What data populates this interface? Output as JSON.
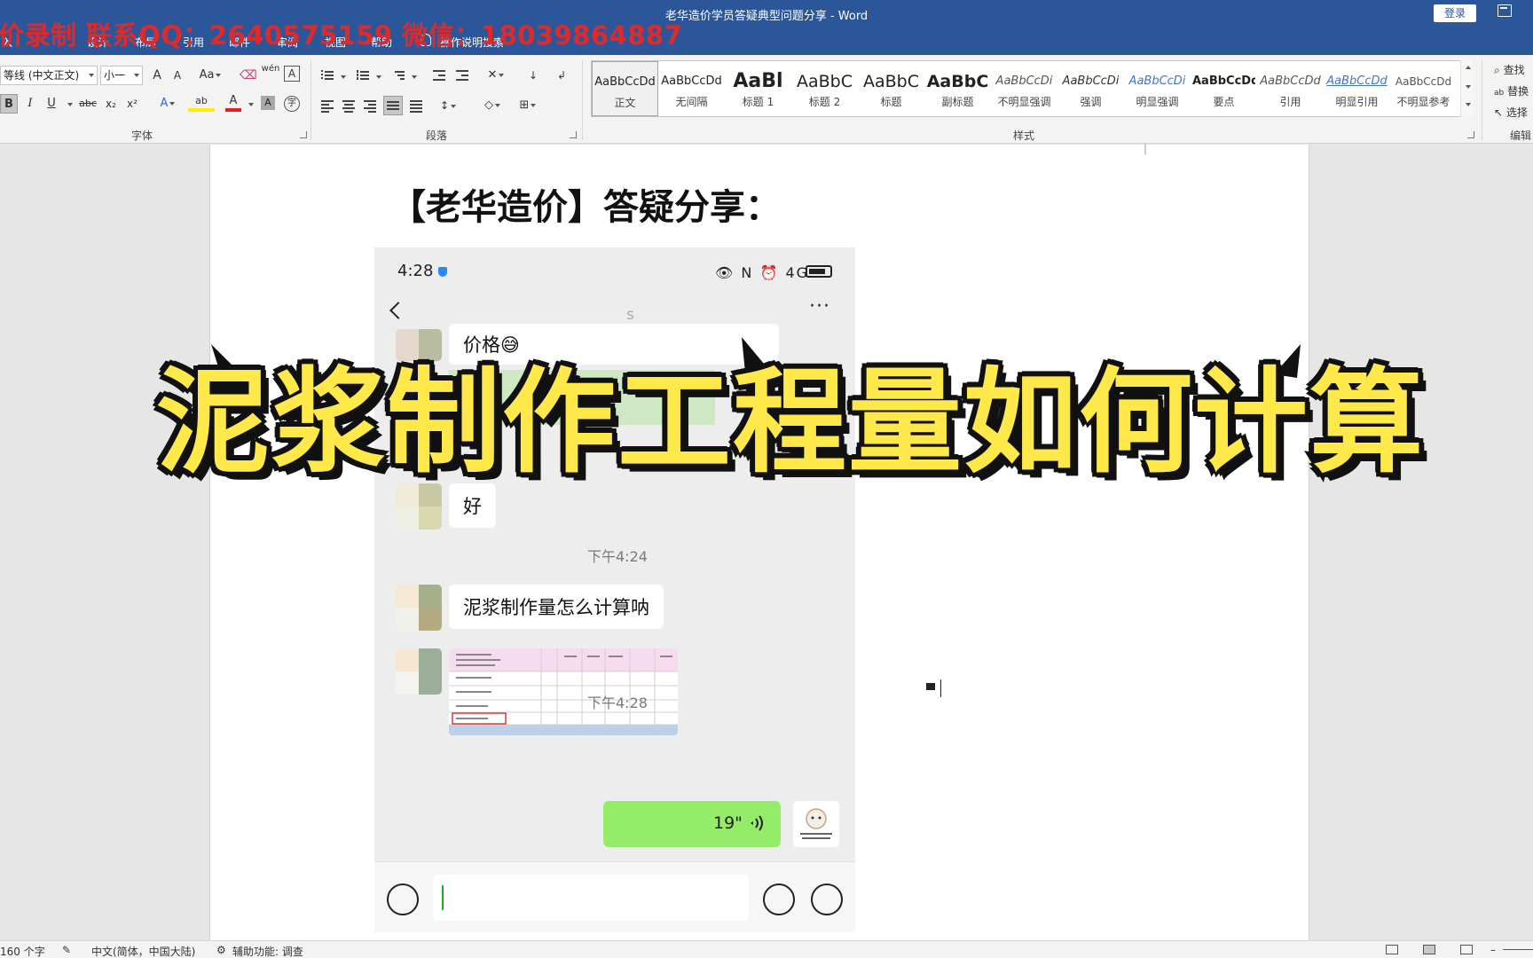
{
  "title_bar": {
    "doc_title": "老华造价学员答疑典型问题分享  -  Word",
    "login_label": "登录"
  },
  "watermark": "价录制 联系QQ：2640575159 微信：18039864887",
  "tabs": [
    "入",
    "设计",
    "布局",
    "引用",
    "邮件",
    "审阅",
    "视图",
    "帮助",
    "操作说明搜索"
  ],
  "ribbon": {
    "font": {
      "font_name": "等线 (中文正文)",
      "font_size": "小一",
      "grow_font": "A",
      "shrink_font": "A",
      "change_case": "Aa",
      "phonetic": "wén",
      "char_border": "A",
      "bold": "B",
      "italic": "I",
      "underline": "U",
      "strike": "abc",
      "subscript": "x₂",
      "superscript": "x²",
      "text_effect": "A",
      "highlight": "ab",
      "font_color": "A",
      "char_shading": "A",
      "enclose_char": "字",
      "group_label": "字体"
    },
    "paragraph": {
      "group_label": "段落"
    },
    "styles": {
      "group_label": "样式",
      "items": [
        {
          "sample": "AaBbCcDd",
          "name": "正文"
        },
        {
          "sample": "AaBbCcDd",
          "name": "无间隔"
        },
        {
          "sample": "AaBl",
          "name": "标题 1"
        },
        {
          "sample": "AaBbC",
          "name": "标题 2"
        },
        {
          "sample": "AaBbC",
          "name": "标题"
        },
        {
          "sample": "AaBbC",
          "name": "副标题"
        },
        {
          "sample": "AaBbCcDi",
          "name": "不明显强调"
        },
        {
          "sample": "AaBbCcDi",
          "name": "强调"
        },
        {
          "sample": "AaBbCcDi",
          "name": "明显强调"
        },
        {
          "sample": "AaBbCcDd",
          "name": "要点"
        },
        {
          "sample": "AaBbCcDd",
          "name": "引用"
        },
        {
          "sample": "AaBbCcDd",
          "name": "明显引用"
        },
        {
          "sample": "AaBbCcDd",
          "name": "不明显参考"
        }
      ]
    },
    "editing": {
      "find": "查找",
      "replace": "替换",
      "select": "选择",
      "group_label": "编辑"
    }
  },
  "document": {
    "heading": "【老华造价】答疑分享：",
    "phone": {
      "status_time": "4:28",
      "status_icons": "👁 N ⏰ 4G",
      "chat_name": "s",
      "more": "···",
      "messages": [
        {
          "text": "价格😅"
        },
        {
          "text": "好"
        },
        {
          "text": "泥浆制作量怎么计算呐"
        }
      ],
      "time_1": "下午4:24",
      "time_2": "下午4:28",
      "voice_duration": "19\""
    },
    "caption": "泥浆制作工程量如何计算"
  },
  "status_bar": {
    "word_count": "160 个字",
    "language": "中文(简体，中国大陆)",
    "accessibility": "辅助功能: 调查"
  }
}
